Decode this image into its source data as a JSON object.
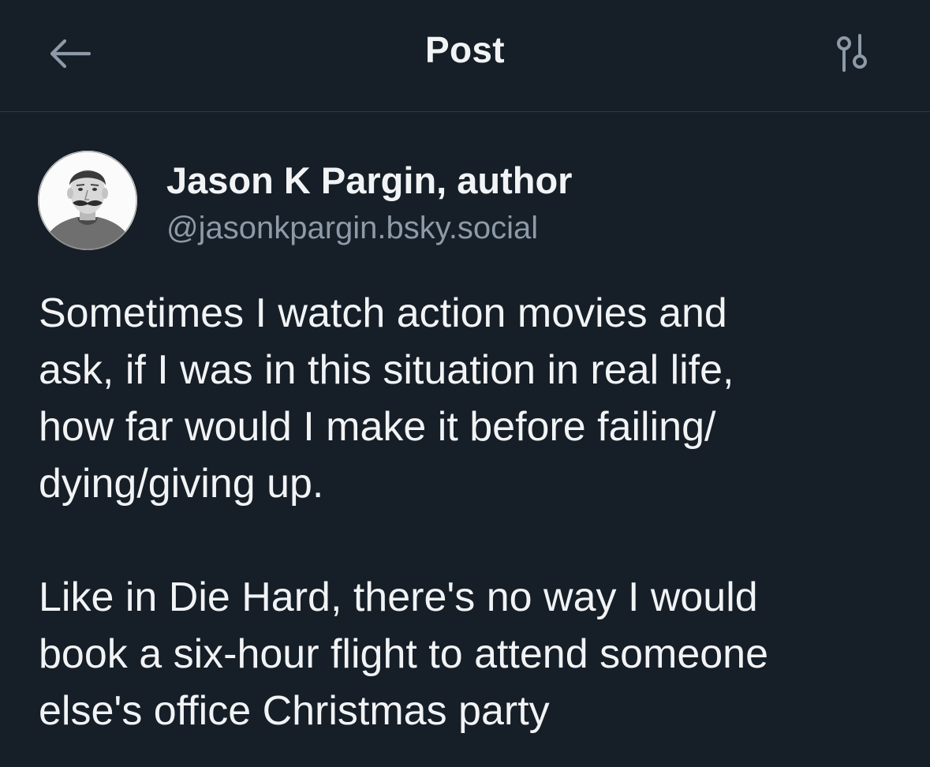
{
  "header": {
    "title": "Post",
    "back_icon": "arrow-left-icon",
    "settings_icon": "sliders-icon"
  },
  "post": {
    "author": {
      "display_name": "Jason K Pargin, author",
      "handle": "@jasonkpargin.bsky.social"
    },
    "paragraphs": [
      "Sometimes I watch action movies and\nask, if I was in this situation in real life,\nhow far would I make it before failing/\ndying/giving up.",
      "Like in Die Hard, there's no way I would\nbook a six-hour flight to attend someone\nelse's office Christmas party"
    ]
  },
  "colors": {
    "background": "#161e27",
    "text": "#f1f3f5",
    "muted_text": "#8d9aa8",
    "divider": "#2e3a47"
  }
}
